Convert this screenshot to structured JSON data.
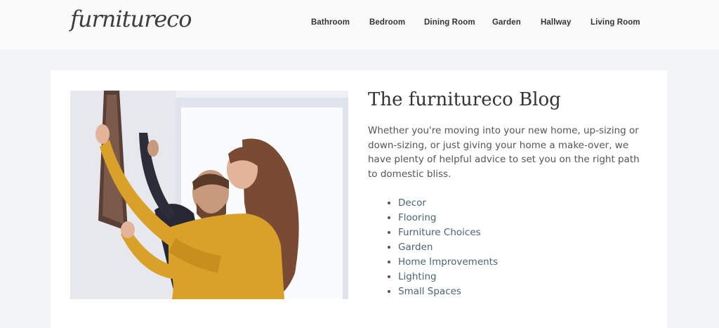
{
  "header": {
    "logo": "furnitureco",
    "nav": [
      "Bathroom",
      "Bedroom",
      "Dining Room",
      "Garden",
      "Hallway",
      "Living Room"
    ]
  },
  "blog": {
    "title": "The furnitureco Blog",
    "intro": "Whether you're moving into your new home, up-sizing or down-sizing, or just giving your home a make-over, we have plenty of helpful advice to set you on the right path to domestic bliss.",
    "categories": [
      "Decor",
      "Flooring",
      "Furniture Choices",
      "Garden",
      "Home Improvements",
      "Lighting",
      "Small Spaces"
    ]
  },
  "colors": {
    "page_bg": "#f3f4f6",
    "header_bg": "#fafafa",
    "card_bg": "#ffffff",
    "link": "#4a6572",
    "text": "#555555",
    "heading": "#333333"
  },
  "icons": {
    "photo": "couple-hanging-picture-photo"
  }
}
